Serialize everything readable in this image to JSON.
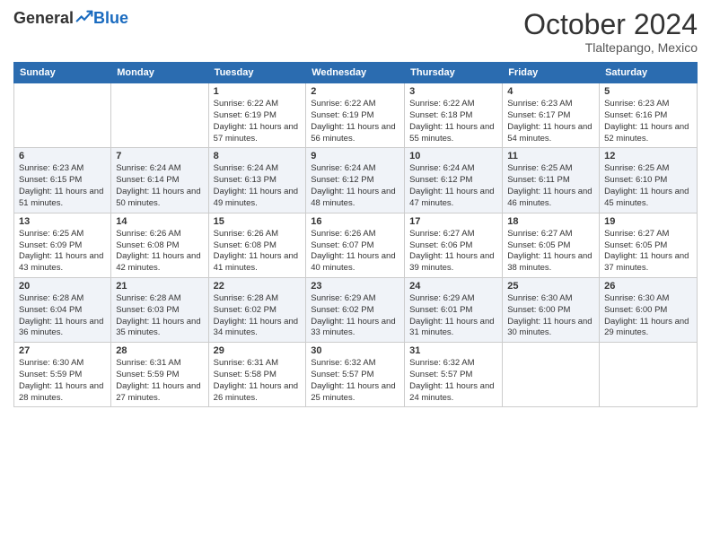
{
  "header": {
    "logo_general": "General",
    "logo_blue": "Blue",
    "month_title": "October 2024",
    "location": "Tlaltepango, Mexico"
  },
  "weekdays": [
    "Sunday",
    "Monday",
    "Tuesday",
    "Wednesday",
    "Thursday",
    "Friday",
    "Saturday"
  ],
  "weeks": [
    [
      {
        "day": "",
        "sunrise": "",
        "sunset": "",
        "daylight": ""
      },
      {
        "day": "",
        "sunrise": "",
        "sunset": "",
        "daylight": ""
      },
      {
        "day": "1",
        "sunrise": "Sunrise: 6:22 AM",
        "sunset": "Sunset: 6:19 PM",
        "daylight": "Daylight: 11 hours and 57 minutes."
      },
      {
        "day": "2",
        "sunrise": "Sunrise: 6:22 AM",
        "sunset": "Sunset: 6:19 PM",
        "daylight": "Daylight: 11 hours and 56 minutes."
      },
      {
        "day": "3",
        "sunrise": "Sunrise: 6:22 AM",
        "sunset": "Sunset: 6:18 PM",
        "daylight": "Daylight: 11 hours and 55 minutes."
      },
      {
        "day": "4",
        "sunrise": "Sunrise: 6:23 AM",
        "sunset": "Sunset: 6:17 PM",
        "daylight": "Daylight: 11 hours and 54 minutes."
      },
      {
        "day": "5",
        "sunrise": "Sunrise: 6:23 AM",
        "sunset": "Sunset: 6:16 PM",
        "daylight": "Daylight: 11 hours and 52 minutes."
      }
    ],
    [
      {
        "day": "6",
        "sunrise": "Sunrise: 6:23 AM",
        "sunset": "Sunset: 6:15 PM",
        "daylight": "Daylight: 11 hours and 51 minutes."
      },
      {
        "day": "7",
        "sunrise": "Sunrise: 6:24 AM",
        "sunset": "Sunset: 6:14 PM",
        "daylight": "Daylight: 11 hours and 50 minutes."
      },
      {
        "day": "8",
        "sunrise": "Sunrise: 6:24 AM",
        "sunset": "Sunset: 6:13 PM",
        "daylight": "Daylight: 11 hours and 49 minutes."
      },
      {
        "day": "9",
        "sunrise": "Sunrise: 6:24 AM",
        "sunset": "Sunset: 6:12 PM",
        "daylight": "Daylight: 11 hours and 48 minutes."
      },
      {
        "day": "10",
        "sunrise": "Sunrise: 6:24 AM",
        "sunset": "Sunset: 6:12 PM",
        "daylight": "Daylight: 11 hours and 47 minutes."
      },
      {
        "day": "11",
        "sunrise": "Sunrise: 6:25 AM",
        "sunset": "Sunset: 6:11 PM",
        "daylight": "Daylight: 11 hours and 46 minutes."
      },
      {
        "day": "12",
        "sunrise": "Sunrise: 6:25 AM",
        "sunset": "Sunset: 6:10 PM",
        "daylight": "Daylight: 11 hours and 45 minutes."
      }
    ],
    [
      {
        "day": "13",
        "sunrise": "Sunrise: 6:25 AM",
        "sunset": "Sunset: 6:09 PM",
        "daylight": "Daylight: 11 hours and 43 minutes."
      },
      {
        "day": "14",
        "sunrise": "Sunrise: 6:26 AM",
        "sunset": "Sunset: 6:08 PM",
        "daylight": "Daylight: 11 hours and 42 minutes."
      },
      {
        "day": "15",
        "sunrise": "Sunrise: 6:26 AM",
        "sunset": "Sunset: 6:08 PM",
        "daylight": "Daylight: 11 hours and 41 minutes."
      },
      {
        "day": "16",
        "sunrise": "Sunrise: 6:26 AM",
        "sunset": "Sunset: 6:07 PM",
        "daylight": "Daylight: 11 hours and 40 minutes."
      },
      {
        "day": "17",
        "sunrise": "Sunrise: 6:27 AM",
        "sunset": "Sunset: 6:06 PM",
        "daylight": "Daylight: 11 hours and 39 minutes."
      },
      {
        "day": "18",
        "sunrise": "Sunrise: 6:27 AM",
        "sunset": "Sunset: 6:05 PM",
        "daylight": "Daylight: 11 hours and 38 minutes."
      },
      {
        "day": "19",
        "sunrise": "Sunrise: 6:27 AM",
        "sunset": "Sunset: 6:05 PM",
        "daylight": "Daylight: 11 hours and 37 minutes."
      }
    ],
    [
      {
        "day": "20",
        "sunrise": "Sunrise: 6:28 AM",
        "sunset": "Sunset: 6:04 PM",
        "daylight": "Daylight: 11 hours and 36 minutes."
      },
      {
        "day": "21",
        "sunrise": "Sunrise: 6:28 AM",
        "sunset": "Sunset: 6:03 PM",
        "daylight": "Daylight: 11 hours and 35 minutes."
      },
      {
        "day": "22",
        "sunrise": "Sunrise: 6:28 AM",
        "sunset": "Sunset: 6:02 PM",
        "daylight": "Daylight: 11 hours and 34 minutes."
      },
      {
        "day": "23",
        "sunrise": "Sunrise: 6:29 AM",
        "sunset": "Sunset: 6:02 PM",
        "daylight": "Daylight: 11 hours and 33 minutes."
      },
      {
        "day": "24",
        "sunrise": "Sunrise: 6:29 AM",
        "sunset": "Sunset: 6:01 PM",
        "daylight": "Daylight: 11 hours and 31 minutes."
      },
      {
        "day": "25",
        "sunrise": "Sunrise: 6:30 AM",
        "sunset": "Sunset: 6:00 PM",
        "daylight": "Daylight: 11 hours and 30 minutes."
      },
      {
        "day": "26",
        "sunrise": "Sunrise: 6:30 AM",
        "sunset": "Sunset: 6:00 PM",
        "daylight": "Daylight: 11 hours and 29 minutes."
      }
    ],
    [
      {
        "day": "27",
        "sunrise": "Sunrise: 6:30 AM",
        "sunset": "Sunset: 5:59 PM",
        "daylight": "Daylight: 11 hours and 28 minutes."
      },
      {
        "day": "28",
        "sunrise": "Sunrise: 6:31 AM",
        "sunset": "Sunset: 5:59 PM",
        "daylight": "Daylight: 11 hours and 27 minutes."
      },
      {
        "day": "29",
        "sunrise": "Sunrise: 6:31 AM",
        "sunset": "Sunset: 5:58 PM",
        "daylight": "Daylight: 11 hours and 26 minutes."
      },
      {
        "day": "30",
        "sunrise": "Sunrise: 6:32 AM",
        "sunset": "Sunset: 5:57 PM",
        "daylight": "Daylight: 11 hours and 25 minutes."
      },
      {
        "day": "31",
        "sunrise": "Sunrise: 6:32 AM",
        "sunset": "Sunset: 5:57 PM",
        "daylight": "Daylight: 11 hours and 24 minutes."
      },
      {
        "day": "",
        "sunrise": "",
        "sunset": "",
        "daylight": ""
      },
      {
        "day": "",
        "sunrise": "",
        "sunset": "",
        "daylight": ""
      }
    ]
  ]
}
